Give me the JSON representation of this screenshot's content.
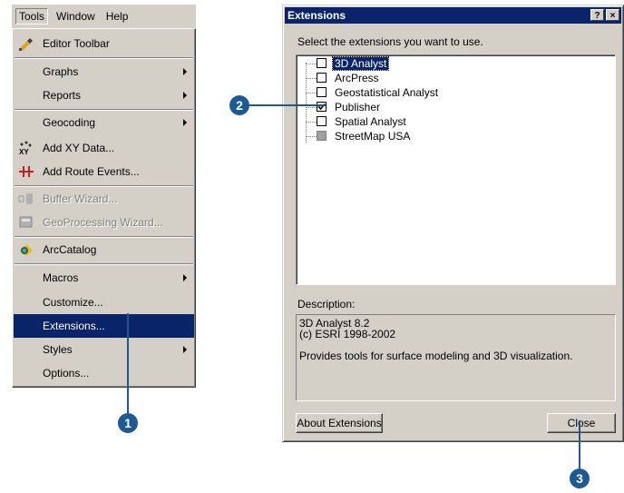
{
  "menubar": {
    "items": [
      "Tools",
      "Window",
      "Help"
    ]
  },
  "tools_menu": {
    "items": [
      {
        "label": "Editor Toolbar",
        "icon": "editor-toolbar-icon",
        "submenu": false,
        "disabled": false
      },
      {
        "label": "Graphs",
        "submenu": true,
        "disabled": false
      },
      {
        "label": "Reports",
        "submenu": true,
        "disabled": false
      },
      {
        "label": "Geocoding",
        "submenu": true,
        "disabled": false
      },
      {
        "label": "Add XY Data...",
        "icon": "add-xy-data-icon",
        "submenu": false,
        "disabled": false
      },
      {
        "label": "Add Route Events...",
        "icon": "add-route-events-icon",
        "submenu": false,
        "disabled": false
      },
      {
        "label": "Buffer Wizard...",
        "icon": "buffer-wizard-icon",
        "submenu": false,
        "disabled": true
      },
      {
        "label": "GeoProcessing Wizard...",
        "icon": "geoprocessing-wizard-icon",
        "submenu": false,
        "disabled": true
      },
      {
        "label": "ArcCatalog",
        "icon": "arccatalog-icon",
        "submenu": false,
        "disabled": false
      },
      {
        "label": "Macros",
        "submenu": true,
        "disabled": false
      },
      {
        "label": "Customize...",
        "submenu": false,
        "disabled": false
      },
      {
        "label": "Extensions...",
        "submenu": false,
        "disabled": false,
        "selected": true
      },
      {
        "label": "Styles",
        "submenu": true,
        "disabled": false
      },
      {
        "label": "Options...",
        "submenu": false,
        "disabled": false
      }
    ]
  },
  "dialog": {
    "title": "Extensions",
    "help_button": "?",
    "close_x": "×",
    "prompt": "Select the extensions you want to use.",
    "extensions": [
      {
        "label": "3D Analyst",
        "checked": false,
        "selected": true,
        "available": true
      },
      {
        "label": "ArcPress",
        "checked": false,
        "selected": false,
        "available": true
      },
      {
        "label": "Geostatistical Analyst",
        "checked": false,
        "selected": false,
        "available": true
      },
      {
        "label": "Publisher",
        "checked": true,
        "selected": false,
        "available": true
      },
      {
        "label": "Spatial Analyst",
        "checked": false,
        "selected": false,
        "available": true
      },
      {
        "label": "StreetMap USA",
        "checked": false,
        "selected": false,
        "available": false
      }
    ],
    "description_label": "Description:",
    "description_text": "3D Analyst 8.2\n(c) ESRI 1998-2002\n\nProvides tools for surface modeling and 3D visualization.",
    "about_button": "About Extensions",
    "close_button": "Close"
  },
  "callouts": [
    "1",
    "2",
    "3"
  ],
  "colors": {
    "callout": "#1b5a93",
    "selection": "#0a246a",
    "face": "#d4d0c8"
  }
}
